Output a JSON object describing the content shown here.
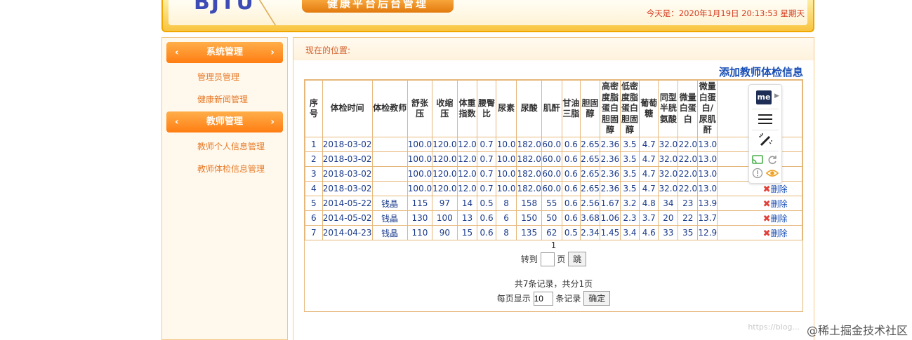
{
  "header": {
    "logo": "BJTU",
    "title": "健康平台后台管理",
    "today_label": "今天是：",
    "today_value": "2020年1月19日 20:13:53 星期天"
  },
  "sidebar": {
    "groups": [
      {
        "label": "系统管理",
        "items": [
          "管理员管理",
          "健康新闻管理"
        ]
      },
      {
        "label": "教师管理",
        "items": [
          "教师个人信息管理",
          "教师体检信息管理"
        ]
      }
    ]
  },
  "main": {
    "location_label": "现在的位置:",
    "heading": "添加教师体检信息"
  },
  "table": {
    "headers": [
      "序号",
      "体检时间",
      "体检教师",
      "舒张压",
      "收缩压",
      "体重指数",
      "腰臀比",
      "尿素",
      "尿酸",
      "肌酐",
      "甘油三脂",
      "胆固醇",
      "高密度脂蛋白胆固醇",
      "低密度脂蛋白胆固醇",
      "葡萄糖",
      "同型半胱氨酸",
      "微量白蛋白",
      "微量白蛋白/尿肌酐",
      ""
    ],
    "rows": [
      [
        "1",
        "2018-03-02",
        "",
        "100.0",
        "120.0",
        "12.0",
        "0.7",
        "10.0",
        "182.0",
        "60.0",
        "0.6",
        "2.65",
        "2.36",
        "3.5",
        "4.7",
        "32.0",
        "22.0",
        "13.0"
      ],
      [
        "2",
        "2018-03-02",
        "",
        "100.0",
        "120.0",
        "12.0",
        "0.7",
        "10.0",
        "182.0",
        "60.0",
        "0.6",
        "2.65",
        "2.36",
        "3.5",
        "4.7",
        "32.0",
        "22.0",
        "13.0"
      ],
      [
        "3",
        "2018-03-02",
        "",
        "100.0",
        "120.0",
        "12.0",
        "0.7",
        "10.0",
        "182.0",
        "60.0",
        "0.6",
        "2.65",
        "2.36",
        "3.5",
        "4.7",
        "32.0",
        "22.0",
        "13.0"
      ],
      [
        "4",
        "2018-03-02",
        "",
        "100.0",
        "120.0",
        "12.0",
        "0.7",
        "10.0",
        "182.0",
        "60.0",
        "0.6",
        "2.65",
        "2.36",
        "3.5",
        "4.7",
        "32.0",
        "22.0",
        "13.0"
      ],
      [
        "5",
        "2014-05-22",
        "钱晶",
        "115",
        "97",
        "14",
        "0.5",
        "8",
        "158",
        "55",
        "0.6",
        "2.56",
        "1.67",
        "3.2",
        "4.8",
        "34",
        "23",
        "13.9"
      ],
      [
        "6",
        "2014-05-02",
        "钱晶",
        "130",
        "100",
        "13",
        "0.6",
        "6",
        "150",
        "50",
        "0.6",
        "3.68",
        "1.06",
        "2.3",
        "3.7",
        "20",
        "22",
        "13.7"
      ],
      [
        "7",
        "2014-04-23",
        "钱晶",
        "110",
        "90",
        "15",
        "0.6",
        "8",
        "135",
        "62",
        "0.5",
        "2.34",
        "1.45",
        "3.4",
        "4.6",
        "33",
        "35",
        "12.9"
      ]
    ],
    "delete_label": "删除",
    "delete_icon": "✖",
    "delete_visible_rows": [
      4,
      5,
      6,
      7
    ]
  },
  "pager": {
    "current_page": "1",
    "goto_label": "转到",
    "page_unit": "页",
    "jump_button": "跳",
    "summary": "共7条记录，共分1页",
    "per_page_label": "每页显示",
    "per_page_value": "10",
    "records_unit": "条记录",
    "confirm_button": "确定"
  },
  "float_toolbar": {
    "badge": "me"
  },
  "watermark": {
    "url": "https://blog...",
    "text": "@稀土掘金技术社区"
  }
}
